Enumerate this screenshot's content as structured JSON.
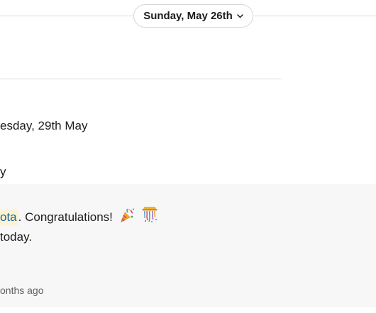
{
  "date_divider": {
    "label": "Sunday, May 26th",
    "chevron_icon": "chevron-down-icon"
  },
  "messages": [
    {
      "text": "esday, 29th May"
    },
    {
      "text": "y"
    }
  ],
  "highlighted_message": {
    "mention": "ota",
    "text_after_mention": ". Congratulations!",
    "emojis": [
      "party-popper-icon",
      "confetti-ball-icon"
    ],
    "second_line": "today.",
    "timestamp": "onths ago"
  },
  "colors": {
    "mention_bg": "#fdf3d2",
    "mention_fg": "#1264a3",
    "highlight_bg": "#f7f7f7"
  }
}
